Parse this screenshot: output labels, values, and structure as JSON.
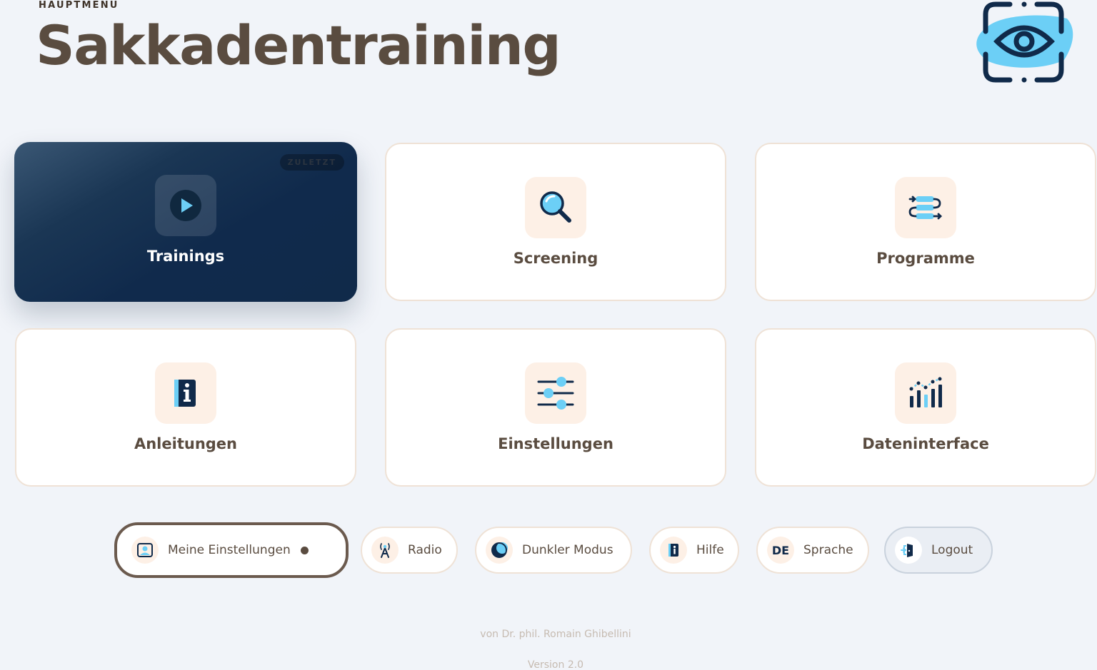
{
  "header": {
    "eyebrow": "HAUPTMENÜ",
    "title": "Sakkadentraining",
    "logo": "eye-logo-icon"
  },
  "cards": [
    {
      "label": "Trainings",
      "icon": "play-icon",
      "active": true,
      "badge": "ZULETZT"
    },
    {
      "label": "Screening",
      "icon": "magnifier-icon"
    },
    {
      "label": "Programme",
      "icon": "program-flow-icon"
    },
    {
      "label": "Anleitungen",
      "icon": "info-book-icon"
    },
    {
      "label": "Einstellungen",
      "icon": "sliders-icon"
    },
    {
      "label": "Dateninterface",
      "icon": "bar-chart-icon"
    }
  ],
  "pills": [
    {
      "label": "Meine Einstellungen",
      "icon": "user-settings-icon"
    },
    {
      "label": "Radio",
      "icon": "radio-tower-icon"
    },
    {
      "label": "Dunkler Modus",
      "icon": "moon-icon"
    },
    {
      "label": "Hilfe",
      "icon": "info-icon"
    },
    {
      "label": "Sprache",
      "icon_text": "DE"
    },
    {
      "label": "Logout",
      "icon": "logout-door-icon"
    }
  ],
  "footer": {
    "author": "von Dr. phil. Romain Ghibellini",
    "version": "Version 2.0"
  },
  "colors": {
    "background": "#f1f4f9",
    "text_brown": "#5a4c40",
    "navy": "#102a4a",
    "sky": "#6ccff6",
    "icon_tile": "#fdf0e6"
  }
}
